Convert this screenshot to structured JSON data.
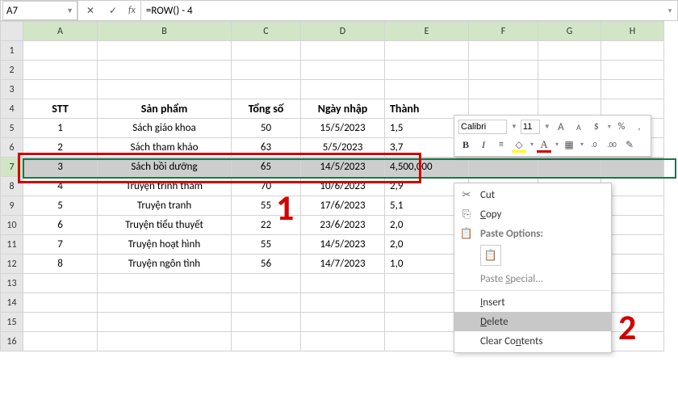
{
  "namebox": {
    "value": "A7"
  },
  "formula": {
    "value": "=ROW() - 4"
  },
  "columns": [
    "A",
    "B",
    "C",
    "D",
    "E",
    "F",
    "G",
    "H"
  ],
  "row_numbers": [
    1,
    2,
    3,
    4,
    5,
    6,
    7,
    8,
    9,
    10,
    11,
    12,
    13,
    14,
    15,
    16
  ],
  "selected_row": 7,
  "headers": {
    "stt": "STT",
    "sanpham": "Sản phẩm",
    "tongso": "Tổng số",
    "ngaynhap": "Ngày nhập",
    "thanh": "Thành"
  },
  "rows": [
    {
      "stt": "1",
      "sp": "Sách giáo khoa",
      "ts": "50",
      "ng": "15/5/2023",
      "th": "1,5"
    },
    {
      "stt": "2",
      "sp": "Sách tham khảo",
      "ts": "63",
      "ng": "5/5/2023",
      "th": "3,7"
    },
    {
      "stt": "3",
      "sp": "Sách bồi dưỡng",
      "ts": "65",
      "ng": "14/5/2023",
      "th": "4,500,000"
    },
    {
      "stt": "4",
      "sp": "Truyện trinh thám",
      "ts": "70",
      "ng": "10/6/2023",
      "th": "2,9"
    },
    {
      "stt": "5",
      "sp": "Truyện tranh",
      "ts": "55",
      "ng": "17/6/2023",
      "th": "5,1"
    },
    {
      "stt": "6",
      "sp": "Truyện tiểu thuyết",
      "ts": "22",
      "ng": "23/6/2023",
      "th": "2,0"
    },
    {
      "stt": "7",
      "sp": "Truyện hoạt hình",
      "ts": "55",
      "ng": "14/5/2023",
      "th": "2,0"
    },
    {
      "stt": "8",
      "sp": "Truyện ngôn tình",
      "ts": "56",
      "ng": "14/7/2023",
      "th": "1,0"
    }
  ],
  "mini": {
    "font": "Calibri",
    "size": "11",
    "a_inc": "A",
    "a_dec": "A",
    "currency": "$",
    "percent": "%",
    "comma": ",",
    "bold": "B",
    "italic": "I",
    "font_color_glyph": "A",
    "fill_glyph": "◧",
    "border_glyph": "▦",
    "dec_inc": ".0",
    "dec_dec": ".00",
    "fmt_paint": "✎"
  },
  "ctx": {
    "cut": "Cut",
    "copy": "Copy",
    "paste_options": "Paste Options:",
    "paste_special": "Paste Special...",
    "insert": "Insert",
    "delete": "Delete",
    "clear": "Clear Contents"
  },
  "annotations": {
    "num1": "1",
    "num2": "2"
  },
  "chart_data": {
    "type": "table",
    "columns": [
      "STT",
      "Sản phẩm",
      "Tổng số",
      "Ngày nhập",
      "Thành"
    ],
    "rows": [
      [
        "1",
        "Sách giáo khoa",
        "50",
        "15/5/2023",
        "1,5"
      ],
      [
        "2",
        "Sách tham khảo",
        "63",
        "5/5/2023",
        "3,7"
      ],
      [
        "3",
        "Sách bồi dưỡng",
        "65",
        "14/5/2023",
        "4,500,000"
      ],
      [
        "4",
        "Truyện trinh thám",
        "70",
        "10/6/2023",
        "2,9"
      ],
      [
        "5",
        "Truyện tranh",
        "55",
        "17/6/2023",
        "5,1"
      ],
      [
        "6",
        "Truyện tiểu thuyết",
        "22",
        "23/6/2023",
        "2,0"
      ],
      [
        "7",
        "Truyện hoạt hình",
        "55",
        "14/5/2023",
        "2,0"
      ],
      [
        "8",
        "Truyện ngôn tình",
        "56",
        "14/7/2023",
        "1,0"
      ]
    ]
  }
}
